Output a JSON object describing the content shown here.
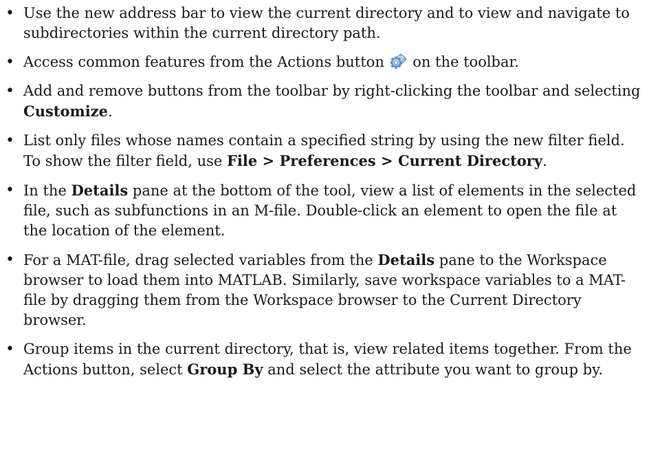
{
  "bullets": [
    {
      "parts": [
        {
          "t": "Use the new address bar to view the current directory and to view and navigate to subdirectories within the current directory path."
        }
      ]
    },
    {
      "parts": [
        {
          "t": "Access common features from the Actions button "
        },
        {
          "t": " on the toolbar."
        }
      ],
      "icon": "gear-icon"
    },
    {
      "parts": [
        {
          "t": "Add and remove buttons from the toolbar by right-clicking the toolbar and selecting "
        },
        {
          "b": "Customize"
        },
        {
          "t": "."
        }
      ]
    },
    {
      "parts": [
        {
          "t": "List only files whose names contain a specified string by using the new filter field. To show the filter field, use "
        },
        {
          "b": "File > Preferences > Current Directory"
        },
        {
          "t": "."
        }
      ]
    },
    {
      "parts": [
        {
          "t": "In the "
        },
        {
          "b": "Details"
        },
        {
          "t": " pane at the bottom of the tool, view a list of elements in the selected file, such as subfunctions in an M-file. Double-click an element to open the file at the location of the element."
        }
      ]
    },
    {
      "parts": [
        {
          "t": "For a MAT-file, drag selected variables from the "
        },
        {
          "b": "Details"
        },
        {
          "t": " pane to the Workspace browser to load them into MATLAB. Similarly, save workspace variables to a MAT-file by dragging them from the Workspace browser to the Current Directory browser."
        }
      ]
    },
    {
      "parts": [
        {
          "t": "Group items in the current directory, that is, view related items together. From the Actions button, select "
        },
        {
          "b": "Group By"
        },
        {
          "t": " and select the attribute you want to group by."
        }
      ]
    }
  ],
  "bullet_glyph": "•"
}
